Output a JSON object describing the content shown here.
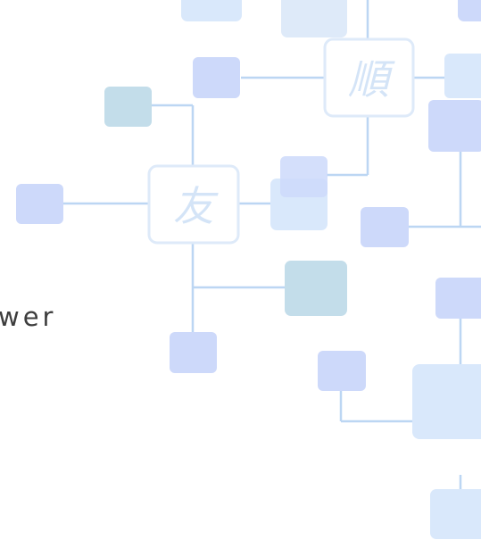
{
  "partial_text": "wer",
  "glyphs": {
    "upper_right": "順",
    "center": "友"
  },
  "colors": {
    "connector": "#bcd6f3",
    "node_blue": "#cdd9fa",
    "node_light": "#d9e8fb",
    "node_teal": "#c3ddea",
    "node_outline": "#deeaf9",
    "glyph": "#d4e4f7",
    "text": "#3d3d3d",
    "background": "#ffffff"
  }
}
